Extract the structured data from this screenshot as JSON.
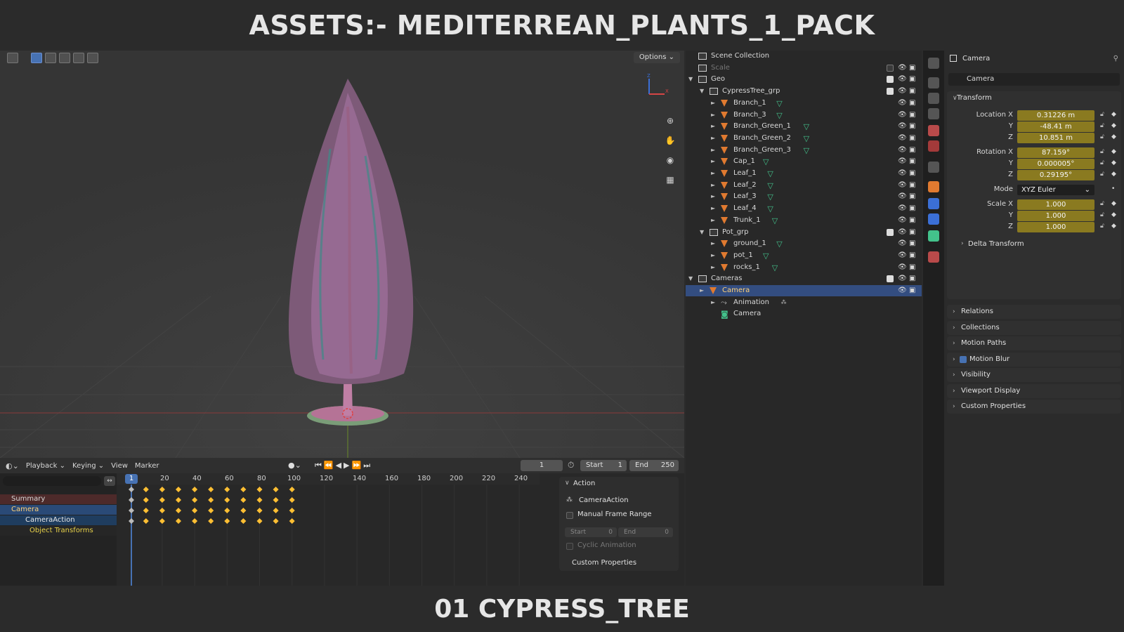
{
  "title": "ASSETS:- MEDITERREAN_PLANTS_1_PACK",
  "footer": "01 CYPRESS_TREE",
  "viewport": {
    "options_label": "Options ⌄",
    "gizmo": {
      "z": "Z",
      "x": "X"
    }
  },
  "timeline": {
    "menus": [
      "Playback ⌄",
      "Keying ⌄",
      "View",
      "Marker"
    ],
    "current_frame": "1",
    "start_label": "Start",
    "start_value": "1",
    "end_label": "End",
    "end_value": "250",
    "ruler": [
      "1",
      "20",
      "40",
      "60",
      "80",
      "100",
      "120",
      "140",
      "160",
      "180",
      "200",
      "220",
      "240"
    ],
    "channels": [
      "Summary",
      "Camera",
      "CameraAction",
      "Object Transforms"
    ],
    "keyframe_frames": [
      1,
      10,
      20,
      30,
      40,
      50,
      60,
      70,
      80,
      90,
      100
    ]
  },
  "action_panel": {
    "header": "Action",
    "action_name": "CameraAction",
    "manual_frame_range": "Manual Frame Range",
    "start_label": "Start",
    "start_value": "0",
    "end_label": "End",
    "end_value": "0",
    "cyclic": "Cyclic Animation",
    "custom_properties": "Custom Properties"
  },
  "outliner": {
    "root": "Scene Collection",
    "rows": [
      {
        "label": "Scale",
        "level": 0,
        "kind": "collection",
        "dim": true
      },
      {
        "label": "Geo",
        "level": 0,
        "kind": "collection",
        "expanded": true
      },
      {
        "label": "CypressTree_grp",
        "level": 1,
        "kind": "collection",
        "expanded": true
      },
      {
        "label": "Branch_1",
        "level": 2,
        "kind": "object"
      },
      {
        "label": "Branch_3",
        "level": 2,
        "kind": "object"
      },
      {
        "label": "Branch_Green_1",
        "level": 2,
        "kind": "object"
      },
      {
        "label": "Branch_Green_2",
        "level": 2,
        "kind": "object"
      },
      {
        "label": "Branch_Green_3",
        "level": 2,
        "kind": "object"
      },
      {
        "label": "Cap_1",
        "level": 2,
        "kind": "object"
      },
      {
        "label": "Leaf_1",
        "level": 2,
        "kind": "object"
      },
      {
        "label": "Leaf_2",
        "level": 2,
        "kind": "object"
      },
      {
        "label": "Leaf_3",
        "level": 2,
        "kind": "object"
      },
      {
        "label": "Leaf_4",
        "level": 2,
        "kind": "object"
      },
      {
        "label": "Trunk_1",
        "level": 2,
        "kind": "object"
      },
      {
        "label": "Pot_grp",
        "level": 1,
        "kind": "collection",
        "expanded": true
      },
      {
        "label": "ground_1",
        "level": 2,
        "kind": "object"
      },
      {
        "label": "pot_1",
        "level": 2,
        "kind": "object"
      },
      {
        "label": "rocks_1",
        "level": 2,
        "kind": "object"
      },
      {
        "label": "Cameras",
        "level": 0,
        "kind": "collection",
        "expanded": true
      },
      {
        "label": "Camera",
        "level": 1,
        "kind": "camera",
        "selected": true
      },
      {
        "label": "Animation",
        "level": 2,
        "kind": "anim"
      },
      {
        "label": "Camera",
        "level": 2,
        "kind": "camdata"
      }
    ]
  },
  "properties": {
    "header": "Camera",
    "object_name": "Camera",
    "transform": {
      "header": "Transform",
      "location": {
        "label": "Location X",
        "x": "0.31226 m",
        "y": "-48.41 m",
        "z": "10.851 m"
      },
      "rotation": {
        "label": "Rotation X",
        "x": "87.159°",
        "y": "0.000005°",
        "z": "0.29195°"
      },
      "mode_label": "Mode",
      "mode_value": "XYZ Euler",
      "scale": {
        "label": "Scale X",
        "x": "1.000",
        "y": "1.000",
        "z": "1.000"
      },
      "axis_y": "Y",
      "axis_z": "Z",
      "delta": "Delta Transform"
    },
    "panels": [
      "Relations",
      "Collections",
      "Motion Paths",
      "Motion Blur",
      "Visibility",
      "Viewport Display",
      "Custom Properties"
    ]
  },
  "colors": {
    "accent_blue": "#4772b3",
    "animated_field": "#8a7a20",
    "object_icon": "#e07a30",
    "mesh_icon": "#43c28b"
  }
}
